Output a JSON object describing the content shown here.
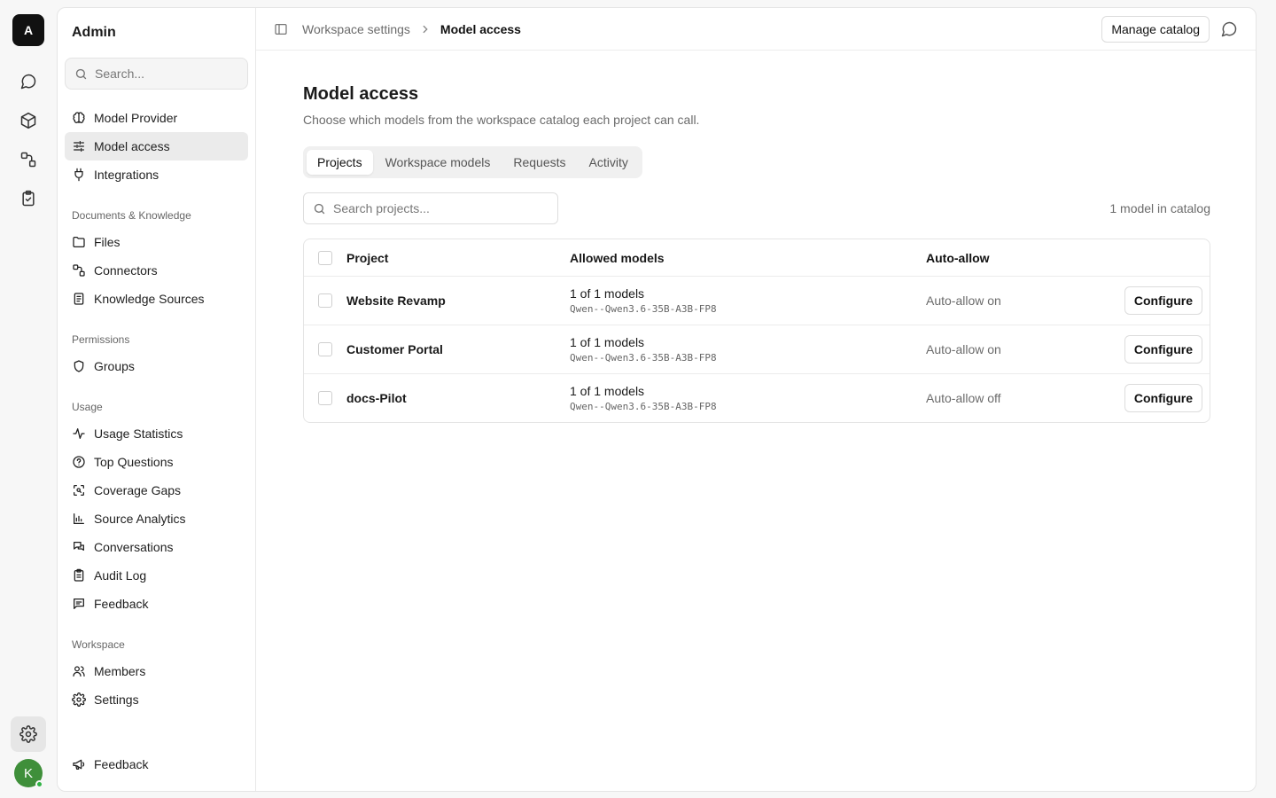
{
  "rail": {
    "logo": "A",
    "avatar_initial": "K",
    "colors": {
      "avatar": "#3f8f3a",
      "online": "#2fb344"
    }
  },
  "sidebar": {
    "title": "Admin",
    "search_placeholder": "Search...",
    "top_items": [
      {
        "label": "Model Provider",
        "icon": "brain-icon"
      },
      {
        "label": "Model access",
        "icon": "sliders-icon",
        "active": true
      },
      {
        "label": "Integrations",
        "icon": "plug-icon"
      }
    ],
    "groups": [
      {
        "label": "Documents & Knowledge",
        "items": [
          "Files",
          "Connectors",
          "Knowledge Sources"
        ]
      },
      {
        "label": "Permissions",
        "items": [
          "Groups"
        ]
      },
      {
        "label": "Usage",
        "items": [
          "Usage Statistics",
          "Top Questions",
          "Coverage Gaps",
          "Source Analytics",
          "Conversations",
          "Audit Log",
          "Feedback"
        ]
      },
      {
        "label": "Workspace",
        "items": [
          "Members",
          "Settings"
        ]
      }
    ],
    "bottom_item": "Feedback"
  },
  "topbar": {
    "breadcrumb": [
      "Workspace settings",
      "Model access"
    ],
    "manage_catalog": "Manage catalog"
  },
  "main": {
    "title": "Model access",
    "subtitle": "Choose which models from the workspace catalog each project can call.",
    "tabs": [
      {
        "label": "Projects",
        "active": true
      },
      {
        "label": "Workspace models"
      },
      {
        "label": "Requests"
      },
      {
        "label": "Activity"
      }
    ],
    "search_placeholder": "Search projects...",
    "catalog_count": "1 model in catalog",
    "table": {
      "headers": [
        "Project",
        "Allowed models",
        "Auto-allow"
      ],
      "rows": [
        {
          "project": "Website Revamp",
          "models_count": "1 of 1 models",
          "model_name": "Qwen--Qwen3.6-35B-A3B-FP8",
          "auto_allow": "Auto-allow on",
          "action": "Configure"
        },
        {
          "project": "Customer Portal",
          "models_count": "1 of 1 models",
          "model_name": "Qwen--Qwen3.6-35B-A3B-FP8",
          "auto_allow": "Auto-allow on",
          "action": "Configure"
        },
        {
          "project": "docs-Pilot",
          "models_count": "1 of 1 models",
          "model_name": "Qwen--Qwen3.6-35B-A3B-FP8",
          "auto_allow": "Auto-allow off",
          "action": "Configure"
        }
      ]
    }
  }
}
